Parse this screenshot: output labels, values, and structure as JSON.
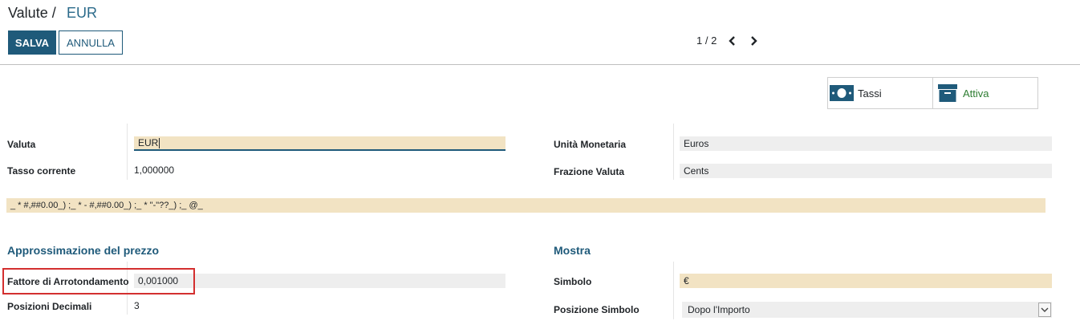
{
  "breadcrumb": {
    "root": "Valute /",
    "current": "EUR"
  },
  "toolbar": {
    "save_label": "SALVA",
    "cancel_label": "ANNULLA"
  },
  "pager": {
    "text": "1 / 2"
  },
  "smart_buttons": {
    "tassi": "Tassi",
    "attiva": "Attiva",
    "attiva_color": "#2e7d32"
  },
  "form": {
    "valuta_label": "Valuta",
    "valuta_value": "EUR",
    "tasso_label": "Tasso corrente",
    "tasso_value": "1,000000",
    "unita_label": "Unità Monetaria",
    "unita_value": "Euros",
    "frazione_label": "Frazione Valuta",
    "frazione_value": "Cents",
    "format_value": "_ * #,##0.00_) ;_ * - #,##0.00_) ;_ * \"-\"??_) ;_ @_"
  },
  "sections": {
    "approx": "Approssimazione del prezzo",
    "mostra": "Mostra"
  },
  "approx": {
    "fattore_label": "Fattore di Arrotondamento",
    "fattore_value": "0,001000",
    "posizioni_label": "Posizioni Decimali",
    "posizioni_value": "3"
  },
  "mostra": {
    "simbolo_label": "Simbolo",
    "simbolo_value": "€",
    "posizione_label": "Posizione Simbolo",
    "posizione_value": "Dopo l'Importo"
  },
  "colors": {
    "primary": "#1f5a7a",
    "required_bg": "#f2e3c3",
    "readonly_bg": "#eeeeee",
    "highlight": "#d32f2f"
  }
}
